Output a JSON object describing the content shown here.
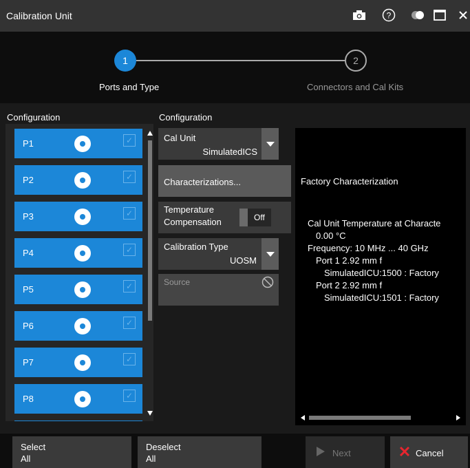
{
  "window": {
    "title": "Calibration Unit"
  },
  "wizard": {
    "steps": [
      {
        "number": "1",
        "label": "Ports and Type"
      },
      {
        "number": "2",
        "label": "Connectors and Cal Kits"
      }
    ]
  },
  "left_section": {
    "title": "Configuration",
    "ports": [
      {
        "label": "P1"
      },
      {
        "label": "P2"
      },
      {
        "label": "P3"
      },
      {
        "label": "P4"
      },
      {
        "label": "P5"
      },
      {
        "label": "P6"
      },
      {
        "label": "P7"
      },
      {
        "label": "P8"
      }
    ]
  },
  "middle_section": {
    "title": "Configuration",
    "cal_unit": {
      "label": "Cal Unit",
      "value": "SimulatedICS"
    },
    "characterizations_button": "Characterizations...",
    "temperature": {
      "label_line1": "Temperature",
      "label_line2": "Compensation",
      "toggle": "Off"
    },
    "calibration_type": {
      "label": "Calibration Type",
      "value": "UOSM"
    },
    "source": {
      "label": "Source"
    }
  },
  "info_panel": {
    "lines": [
      "Factory Characterization",
      "Cal Unit Temperature at Characte",
      "0.00 °C",
      "Frequency: 10 MHz ... 40 GHz",
      "Port 1 2.92 mm f",
      "SimulatedICU:1500 : Factory",
      "Port 2 2.92 mm f",
      "SimulatedICU:1501 : Factory"
    ]
  },
  "bottom_bar": {
    "select_all": {
      "line1": "Select",
      "line2": "All"
    },
    "deselect_all": {
      "line1": "Deselect",
      "line2": "All"
    },
    "next": "Next",
    "cancel": "Cancel"
  },
  "colors": {
    "accent": "#1c87d8",
    "titlebar": "#333333",
    "panel": "#3a3a3a",
    "cancel_icon": "#e8252e"
  },
  "icons": [
    "camera-icon",
    "help-icon",
    "toggle-icon",
    "maximize-icon",
    "close-icon",
    "check-icon",
    "no-entry-icon",
    "play-icon"
  ]
}
